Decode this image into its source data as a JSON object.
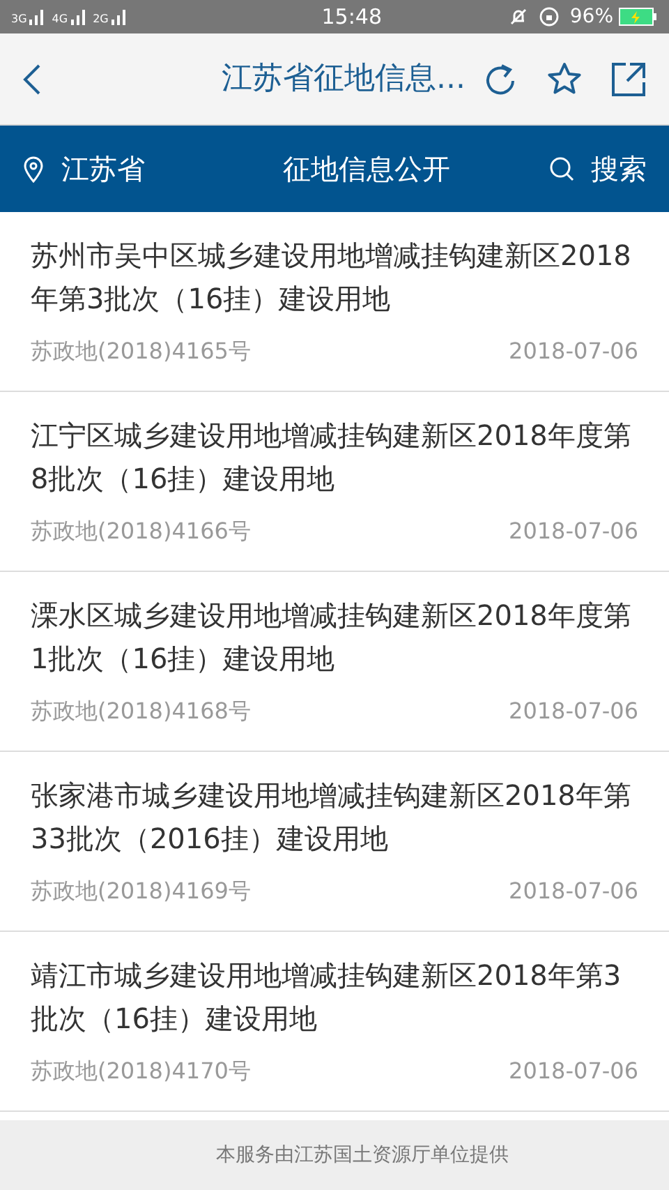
{
  "status_bar": {
    "networks": [
      "3G",
      "4G",
      "2G"
    ],
    "time": "15:48",
    "battery": "96%"
  },
  "header": {
    "title": "江苏省征地信息..."
  },
  "nav": {
    "region": "江苏省",
    "title": "征地信息公开",
    "search": "搜索"
  },
  "items": [
    {
      "title": "苏州市吴中区城乡建设用地增减挂钩建新区2018年第3批次（16挂）建设用地",
      "code": "苏政地(2018)4165号",
      "date": "2018-07-06"
    },
    {
      "title": "江宁区城乡建设用地增减挂钩建新区2018年度第8批次（16挂）建设用地",
      "code": "苏政地(2018)4166号",
      "date": "2018-07-06"
    },
    {
      "title": "溧水区城乡建设用地增减挂钩建新区2018年度第1批次（16挂）建设用地",
      "code": "苏政地(2018)4168号",
      "date": "2018-07-06"
    },
    {
      "title": "张家港市城乡建设用地增减挂钩建新区2018年第33批次（2016挂）建设用地",
      "code": "苏政地(2018)4169号",
      "date": "2018-07-06"
    },
    {
      "title": "靖江市城乡建设用地增减挂钩建新区2018年第3批次（16挂）建设用地",
      "code": "苏政地(2018)4170号",
      "date": "2018-07-06"
    }
  ],
  "footer": "本服务由江苏国土资源厅单位提供"
}
